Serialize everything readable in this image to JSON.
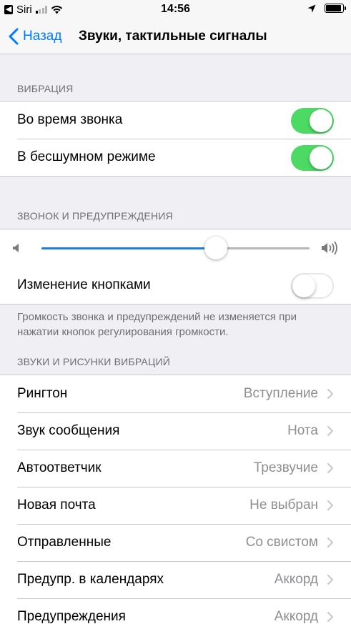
{
  "status_bar": {
    "carrier": "Siri",
    "time": "14:56"
  },
  "nav": {
    "back_label": "Назад",
    "title": "Звуки, тактильные сигналы"
  },
  "vibration": {
    "header": "ВИБРАЦИЯ",
    "items": [
      {
        "label": "Во время звонка",
        "on": true
      },
      {
        "label": "В бесшумном режиме",
        "on": true
      }
    ]
  },
  "ringer": {
    "header": "ЗВОНОК И ПРЕДУПРЕЖДЕНИЯ",
    "volume_fraction": 0.65,
    "change_with_buttons_label": "Изменение кнопками",
    "change_with_buttons_on": false,
    "footer": "Громкость звонка и предупреждений не изменяется при нажатии кнопок регулирования громкости."
  },
  "sounds": {
    "header": "ЗВУКИ И РИСУНКИ ВИБРАЦИЙ",
    "items": [
      {
        "label": "Рингтон",
        "value": "Вступление"
      },
      {
        "label": "Звук сообщения",
        "value": "Нота"
      },
      {
        "label": "Автоответчик",
        "value": "Трезвучие"
      },
      {
        "label": "Новая почта",
        "value": "Не выбран"
      },
      {
        "label": "Отправленные",
        "value": "Со свистом"
      },
      {
        "label": "Предупр. в календарях",
        "value": "Аккорд"
      },
      {
        "label": "Предупреждения",
        "value": "Аккорд"
      }
    ]
  },
  "colors": {
    "accent": "#007aff",
    "toggle_on": "#4cd964",
    "slider_fill": "#1f7ed8"
  },
  "icons": {
    "back": "chevron-left-icon",
    "disclosure": "chevron-right-icon",
    "volume_low": "speaker-low-icon",
    "volume_high": "speaker-high-icon"
  }
}
